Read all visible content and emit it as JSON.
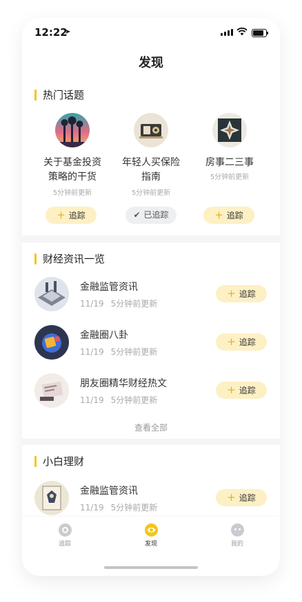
{
  "status_bar": {
    "time": "12:22"
  },
  "header": {
    "title": "发现"
  },
  "hot_topics": {
    "title": "热门话题",
    "items": [
      {
        "name_line1": "关于基金投资",
        "name_line2": "策略的干货",
        "update": "5分钟前更新",
        "action": "追踪",
        "followed": false
      },
      {
        "name_line1": "年轻人买保险",
        "name_line2": "指南",
        "update": "5分钟前更新",
        "action": "已追踪",
        "followed": true
      },
      {
        "name_line1": "房事二三事",
        "name_line2": "",
        "update": "5分钟前更新",
        "action": "追踪",
        "followed": false
      }
    ]
  },
  "finance_news": {
    "title": "财经资讯一览",
    "items": [
      {
        "title": "金融监管资讯",
        "date": "11/19",
        "update": "5分钟前更新",
        "action": "追踪"
      },
      {
        "title": "金融圈八卦",
        "date": "11/19",
        "update": "5分钟前更新",
        "action": "追踪"
      },
      {
        "title": "朋友圈精华财经热文",
        "date": "11/19",
        "update": "5分钟前更新",
        "action": "追踪"
      }
    ],
    "view_all": "查看全部"
  },
  "beginner": {
    "title": "小白理财",
    "items": [
      {
        "title": "金融监管资讯",
        "date": "11/19",
        "update": "5分钟前更新",
        "action": "追踪"
      }
    ]
  },
  "tabbar": {
    "tabs": [
      {
        "label": "追踪",
        "active": false
      },
      {
        "label": "发现",
        "active": true
      },
      {
        "label": "我的",
        "active": false
      }
    ]
  },
  "colors": {
    "accent": "#f5c518",
    "follow_bg": "#fdf0c4",
    "followed_bg": "#eeeff1",
    "page_bg": "#f5f5f7"
  }
}
